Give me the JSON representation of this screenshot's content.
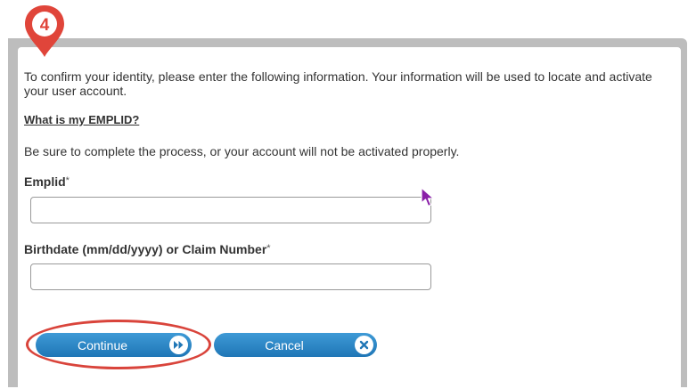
{
  "step_marker": {
    "number": "4",
    "color": "#e0453a"
  },
  "form": {
    "intro_text": "To confirm your identity, please enter the following information. Your information will be used to locate and activate your user account.",
    "help_link": "What is my EMPLID?",
    "notice_text": "Be sure to complete the process, or your account will not be activated properly.",
    "fields": [
      {
        "label": "Emplid",
        "required_mark": "*",
        "value": "",
        "placeholder": ""
      },
      {
        "label": "Birthdate (mm/dd/yyyy) or Claim Number",
        "required_mark": "*",
        "value": "",
        "placeholder": ""
      }
    ],
    "buttons": {
      "continue_label": "Continue",
      "continue_icon": "double-chevron-right-icon",
      "cancel_label": "Cancel",
      "cancel_icon": "close-icon"
    }
  },
  "colors": {
    "button_blue": "#2a86c8",
    "annotation_red": "#d9443b",
    "frame_gray": "#bdbdbd",
    "cursor_purple": "#8a1fa8"
  }
}
